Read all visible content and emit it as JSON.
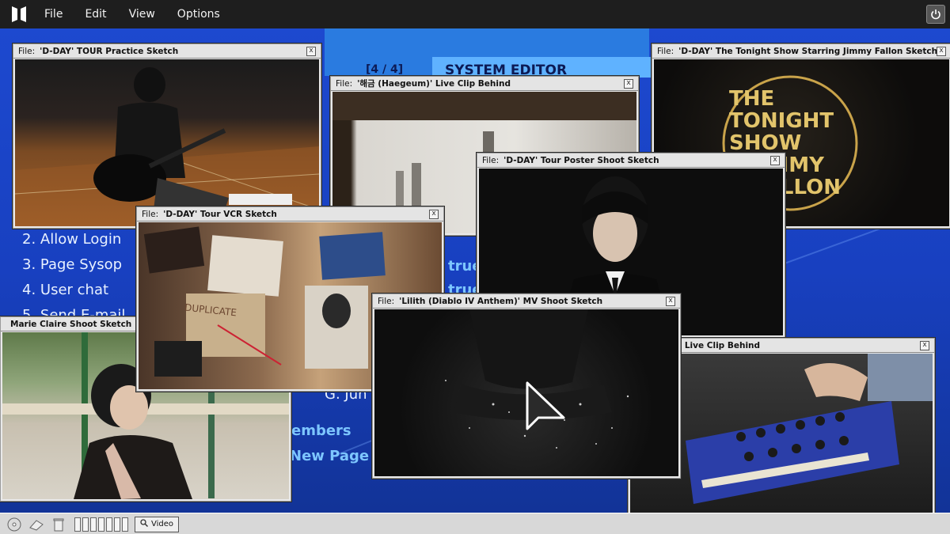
{
  "menubar": {
    "logo_icon": "bts-logo-icon",
    "items": [
      "File",
      "Edit",
      "View",
      "Options"
    ],
    "power_icon": "power-icon"
  },
  "background": {
    "pager": "[4 / 4]",
    "editor_title": "SYSTEM EDITOR",
    "menu_list": [
      "2. Allow Login",
      "3. Page Sysop",
      "4. User chat",
      "5. Send E-mail"
    ],
    "fragments": [
      "true",
      "true",
      "G. Jun",
      "embers",
      "New Page"
    ]
  },
  "windows": [
    {
      "id": "practice",
      "label": "File:",
      "title": "'D-DAY' TOUR Practice Sketch",
      "close": "x"
    },
    {
      "id": "haegeum",
      "label": "File:",
      "title": "'해금 (Haegeum)' Live Clip Behind",
      "close": "x"
    },
    {
      "id": "tonight",
      "label": "File:",
      "title": "'D-DAY' The Tonight Show Starring Jimmy Fallon Sketch",
      "close": "x"
    },
    {
      "id": "poster",
      "label": "File:",
      "title": "'D-DAY' Tour Poster Shoot Sketch",
      "close": "x"
    },
    {
      "id": "vcr",
      "label": "File:",
      "title": "'D-DAY' Tour VCR Sketch",
      "close": "x"
    },
    {
      "id": "lilith",
      "label": "File:",
      "title": "'Lilith (Diablo IV Anthem)' MV Shoot Sketch",
      "close": "x"
    },
    {
      "id": "marie",
      "label": "",
      "title": "Marie Claire Shoot Sketch",
      "close": ""
    },
    {
      "id": "live2",
      "label": "",
      "title": "' Live Clip Behind",
      "close": "x"
    }
  ],
  "tonight_logo": {
    "line1": "THE",
    "line2": "TONIGHT",
    "line3": "SHOW",
    "line4": "JIMMY",
    "line5": "FALLON"
  },
  "vcr_note": "DUPLICATE",
  "taskbar": {
    "icons": [
      "cd-icon",
      "eraser-icon",
      "trash-icon"
    ],
    "video_label": "Video",
    "video_icon": "magnifier-icon"
  },
  "colors": {
    "desktop": "#1a3fb8",
    "menubar": "#1e1e1e",
    "accent_text": "#7dc6ff"
  }
}
